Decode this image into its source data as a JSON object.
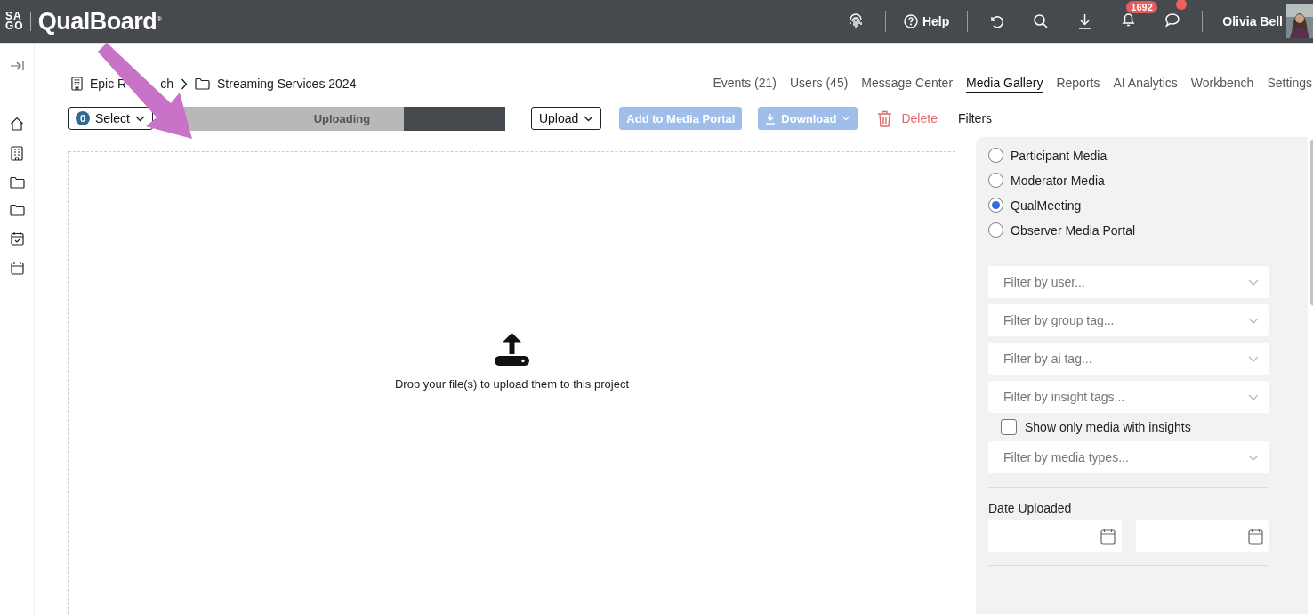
{
  "logo": {
    "mark_top": "SA",
    "mark_bottom": "GO",
    "name": "QualBoard",
    "registered": "®"
  },
  "topbar": {
    "help": "Help",
    "notifications": "1692",
    "chat_unread": true,
    "user": "Olivia Bell"
  },
  "breadcrumb": [
    {
      "fragments": [
        "Epic R",
        "ch"
      ]
    },
    {
      "fragments": [
        "Streaming Services 2024"
      ]
    }
  ],
  "nav": [
    {
      "label": "Events (21)",
      "selected": false
    },
    {
      "label": "Users (45)",
      "selected": false
    },
    {
      "label": "Message Center",
      "selected": false
    },
    {
      "label": "Media Gallery",
      "selected": true
    },
    {
      "label": "Reports",
      "selected": false
    },
    {
      "label": "AI Analytics",
      "selected": false
    },
    {
      "label": "Workbench",
      "selected": false
    },
    {
      "label": "Settings",
      "selected": false
    }
  ],
  "toolbar": {
    "select_count": "0",
    "select": "Select",
    "upload_progress": {
      "label": "Uploading",
      "level": 0.69
    },
    "upload": "Upload",
    "add_to_portal": {
      "label": "Add to Media Portal",
      "disabled": true
    },
    "download": {
      "label": "Download",
      "disabled": true
    },
    "delete": "Delete",
    "filters": "Filters"
  },
  "dropzone": {
    "text": "Drop your file(s) to upload them to this project"
  },
  "filters": {
    "sources": [
      {
        "label": "Participant Media",
        "selected": false
      },
      {
        "label": "Moderator Media",
        "selected": false
      },
      {
        "label": "QualMeeting",
        "selected": true
      },
      {
        "label": "Observer Media Portal",
        "selected": false
      }
    ],
    "dropdowns": [
      {
        "placeholder": "Filter by user..."
      },
      {
        "placeholder": "Filter by group tag..."
      },
      {
        "placeholder": "Filter by ai tag..."
      },
      {
        "placeholder": "Filter by insight tags..."
      }
    ],
    "insights_only": {
      "label": "Show only media with insights",
      "checked": false
    },
    "media_types": {
      "placeholder": "Filter by media types..."
    },
    "date_uploaded": "Date Uploaded"
  }
}
